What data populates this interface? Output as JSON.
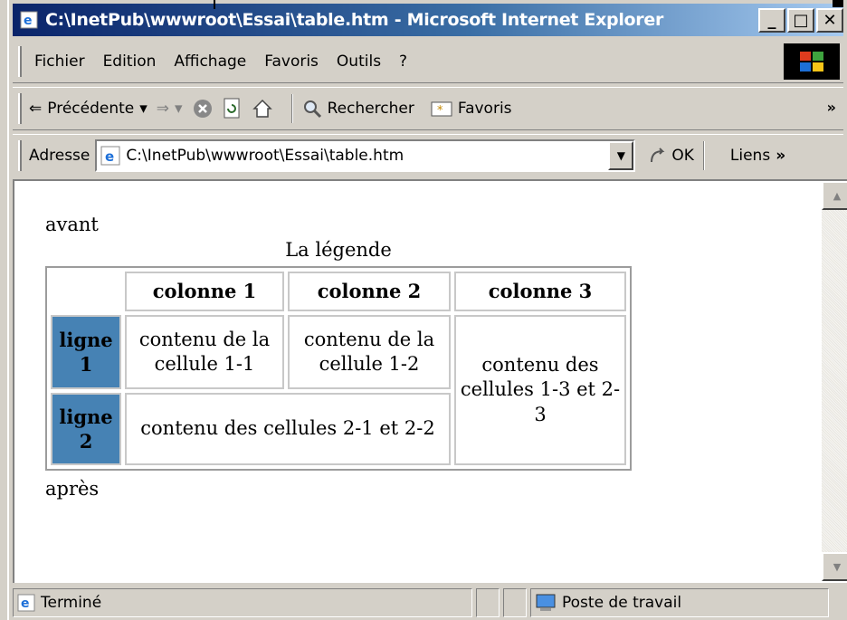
{
  "window": {
    "title": "C:\\InetPub\\wwwroot\\Essai\\table.htm - Microsoft Internet Explorer",
    "minimize_label": "_",
    "maximize_label": "□",
    "close_label": "✕"
  },
  "menu": {
    "items": [
      "Fichier",
      "Edition",
      "Affichage",
      "Favoris",
      "Outils",
      "?"
    ]
  },
  "toolbar": {
    "back_label": "Précédente",
    "back_arrow": "⇐",
    "forward_arrow": "⇒",
    "dropdown_glyph": "▾",
    "search_label": "Rechercher",
    "favorites_label": "Favoris",
    "more_glyph": "»"
  },
  "address": {
    "label": "Adresse",
    "value": "C:\\InetPub\\wwwroot\\Essai\\table.htm",
    "go_label": "OK",
    "links_label": "Liens",
    "links_more": "»"
  },
  "page": {
    "before_text": "avant",
    "after_text": "après",
    "table": {
      "caption": "La légende",
      "headers": [
        "colonne 1",
        "colonne 2",
        "colonne 3"
      ],
      "row1_header": "ligne 1",
      "row2_header": "ligne 2",
      "cell_1_1": "contenu de la cellule 1-1",
      "cell_1_2": "contenu de la cellule 1-2",
      "cell_1_3_2_3": "contenu des cellules 1-3 et 2-3",
      "cell_2_1_2_2": "contenu des cellules 2-1 et 2-2"
    }
  },
  "status": {
    "text": "Terminé",
    "zone": "Poste de travail"
  },
  "colors": {
    "title_gradient_start": "#0a246a",
    "title_gradient_end": "#a6caf0",
    "row_header_bg": "#4682b4",
    "chrome": "#d4d0c8"
  },
  "icons": [
    "ie-page-icon",
    "back-arrow-icon",
    "forward-arrow-icon",
    "stop-icon",
    "refresh-icon",
    "home-icon",
    "search-icon",
    "favorites-icon",
    "go-icon",
    "computer-icon",
    "windows-logo-icon"
  ]
}
